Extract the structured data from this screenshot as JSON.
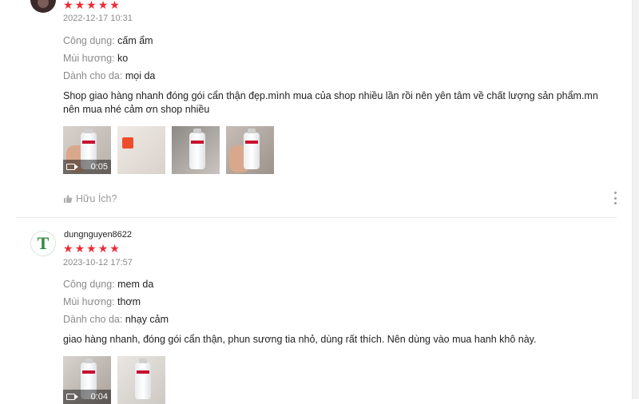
{
  "reviews": [
    {
      "username": "",
      "rating": 5,
      "datetime": "2022-12-17 10:31",
      "attributes": [
        {
          "key": "Công dụng:",
          "value": "cấm ẩm"
        },
        {
          "key": "Mùi hương:",
          "value": "ko"
        },
        {
          "key": "Dành cho da:",
          "value": "mọi da"
        }
      ],
      "comment": "Shop giao hàng nhanh đóng gói cẩn thận đẹp.mình mua của shop nhiều lần rồi nên yên tâm về chất lượng sản phẩm.mn nên mua nhé cảm ơn shop nhiều",
      "video_duration": "0:05",
      "helpful_label": "Hữu Ích?"
    },
    {
      "username": "dungnguyen8622",
      "avatar_letter": "T",
      "rating": 5,
      "datetime": "2023-10-12 17:57",
      "attributes": [
        {
          "key": "Công dụng:",
          "value": "mem da"
        },
        {
          "key": "Mùi hương:",
          "value": "thơm"
        },
        {
          "key": "Dành cho da:",
          "value": "nhạy cảm"
        }
      ],
      "comment": "giao hàng nhanh, đóng gói cẩn thận, phun sương tia nhỏ, dùng rất thích. Nên dùng vào mua hanh khô này.",
      "video_duration": "0:04"
    }
  ],
  "colors": {
    "star": "#ee2a35",
    "muted": "#8a8a8a",
    "text": "#222222",
    "divider": "#e9e9e9"
  },
  "icons": [
    "star-icon",
    "video-camera-icon",
    "thumbs-up-icon",
    "more-vertical-icon"
  ]
}
